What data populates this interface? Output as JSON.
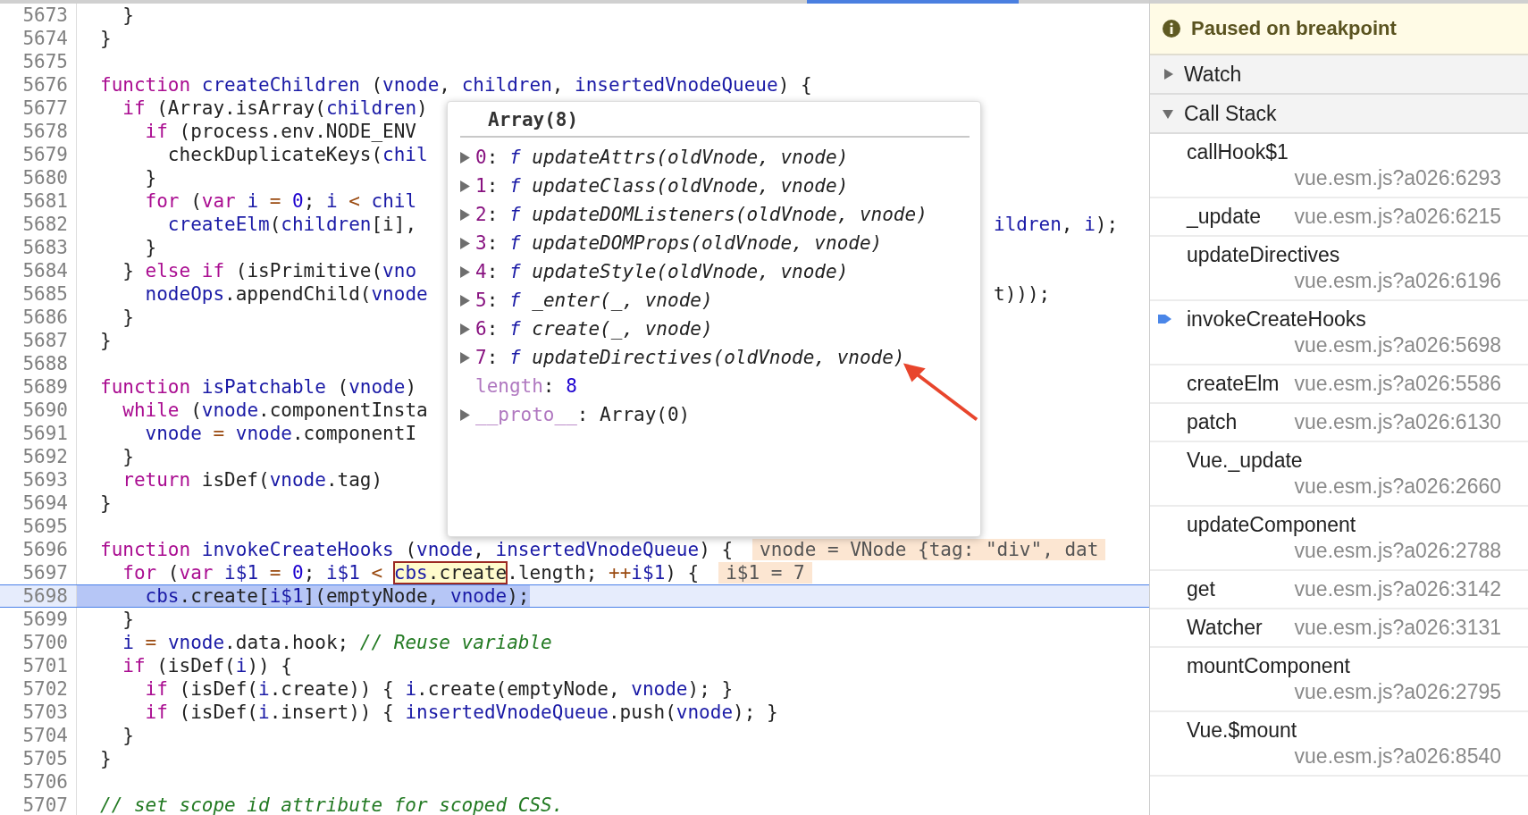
{
  "editor": {
    "lines": [
      {
        "number": "5673",
        "current": false,
        "tokens": [
          {
            "text": "  }",
            "kind": "plain"
          }
        ]
      },
      {
        "number": "5674",
        "current": false,
        "tokens": [
          {
            "text": "}",
            "kind": "plain"
          }
        ]
      },
      {
        "number": "5675",
        "current": false
      },
      {
        "number": "5676",
        "current": false,
        "tokens": [
          {
            "text": "function",
            "kind": "kw"
          },
          {
            "text": " createChildren",
            "kind": "var"
          },
          {
            "text": " (",
            "kind": "plain"
          },
          {
            "text": "vnode",
            "kind": "var"
          },
          {
            "text": ", ",
            "kind": "plain"
          },
          {
            "text": "children",
            "kind": "var"
          },
          {
            "text": ", ",
            "kind": "plain"
          },
          {
            "text": "insertedVnodeQueue",
            "kind": "var"
          },
          {
            "text": ") {",
            "kind": "plain"
          }
        ]
      },
      {
        "number": "5677",
        "current": false,
        "tokens": [
          {
            "text": "  if",
            "kind": "kw"
          },
          {
            "text": " (Array.isArray(",
            "kind": "plain"
          },
          {
            "text": "children",
            "kind": "var"
          },
          {
            "text": ")",
            "kind": "plain"
          }
        ]
      },
      {
        "number": "5678",
        "current": false,
        "tokens": [
          {
            "text": "    if",
            "kind": "kw"
          },
          {
            "text": " (process.env.NODE_ENV",
            "kind": "plain"
          }
        ]
      },
      {
        "number": "5679",
        "current": false,
        "tokens": [
          {
            "text": "      checkDuplicateKeys(",
            "kind": "plain"
          },
          {
            "text": "chil",
            "kind": "var"
          }
        ]
      },
      {
        "number": "5680",
        "current": false,
        "tokens": [
          {
            "text": "    }",
            "kind": "plain"
          }
        ]
      },
      {
        "number": "5681",
        "current": false,
        "tokens": [
          {
            "text": "    for",
            "kind": "kw"
          },
          {
            "text": " (",
            "kind": "plain"
          },
          {
            "text": "var",
            "kind": "kw"
          },
          {
            "text": " i",
            "kind": "var"
          },
          {
            "text": " =",
            "kind": "op"
          },
          {
            "text": " 0",
            "kind": "num"
          },
          {
            "text": "; ",
            "kind": "plain"
          },
          {
            "text": "i",
            "kind": "var"
          },
          {
            "text": " <",
            "kind": "op"
          },
          {
            "text": " chil",
            "kind": "var"
          }
        ]
      },
      {
        "number": "5682",
        "current": false,
        "tokens": [
          {
            "text": "      createElm",
            "kind": "var"
          },
          {
            "text": "(",
            "kind": "plain"
          },
          {
            "text": "children",
            "kind": "var"
          },
          {
            "text": "[i],",
            "kind": "plain"
          }
        ],
        "tail": [
          {
            "text": "ildren",
            "kind": "var"
          },
          {
            "text": ", ",
            "kind": "plain"
          },
          {
            "text": "i",
            "kind": "var"
          },
          {
            "text": ");",
            "kind": "plain"
          }
        ]
      },
      {
        "number": "5683",
        "current": false,
        "tokens": [
          {
            "text": "    }",
            "kind": "plain"
          }
        ]
      },
      {
        "number": "5684",
        "current": false,
        "tokens": [
          {
            "text": "  } ",
            "kind": "plain"
          },
          {
            "text": "else",
            "kind": "kw"
          },
          {
            "text": " if",
            "kind": "kw"
          },
          {
            "text": " (isPrimitive(",
            "kind": "plain"
          },
          {
            "text": "vno",
            "kind": "var"
          }
        ]
      },
      {
        "number": "5685",
        "current": false,
        "tokens": [
          {
            "text": "    nodeOps",
            "kind": "var"
          },
          {
            "text": ".appendChild(",
            "kind": "plain"
          },
          {
            "text": "vnode",
            "kind": "var"
          }
        ],
        "tail": [
          {
            "text": "t)));",
            "kind": "plain"
          }
        ]
      },
      {
        "number": "5686",
        "current": false,
        "tokens": [
          {
            "text": "  }",
            "kind": "plain"
          }
        ]
      },
      {
        "number": "5687",
        "current": false,
        "tokens": [
          {
            "text": "}",
            "kind": "plain"
          }
        ]
      },
      {
        "number": "5688",
        "current": false
      },
      {
        "number": "5689",
        "current": false,
        "tokens": [
          {
            "text": "function",
            "kind": "kw"
          },
          {
            "text": " isPatchable",
            "kind": "var"
          },
          {
            "text": " (",
            "kind": "plain"
          },
          {
            "text": "vnode",
            "kind": "var"
          },
          {
            "text": ")",
            "kind": "plain"
          }
        ]
      },
      {
        "number": "5690",
        "current": false,
        "tokens": [
          {
            "text": "  while",
            "kind": "kw"
          },
          {
            "text": " (",
            "kind": "plain"
          },
          {
            "text": "vnode",
            "kind": "var"
          },
          {
            "text": ".componentInsta",
            "kind": "plain"
          }
        ]
      },
      {
        "number": "5691",
        "current": false,
        "tokens": [
          {
            "text": "    vnode",
            "kind": "var"
          },
          {
            "text": " =",
            "kind": "op"
          },
          {
            "text": " vnode",
            "kind": "var"
          },
          {
            "text": ".componentI",
            "kind": "plain"
          }
        ]
      },
      {
        "number": "5692",
        "current": false,
        "tokens": [
          {
            "text": "  }",
            "kind": "plain"
          }
        ]
      },
      {
        "number": "5693",
        "current": false,
        "tokens": [
          {
            "text": "  return",
            "kind": "kw"
          },
          {
            "text": " isDef(",
            "kind": "plain"
          },
          {
            "text": "vnode",
            "kind": "var"
          },
          {
            "text": ".tag)",
            "kind": "plain"
          }
        ]
      },
      {
        "number": "5694",
        "current": false,
        "tokens": [
          {
            "text": "}",
            "kind": "plain"
          }
        ]
      },
      {
        "number": "5695",
        "current": false
      },
      {
        "number": "5696",
        "current": false,
        "tokens": [
          {
            "text": "function",
            "kind": "kw"
          },
          {
            "text": " invokeCreateHooks",
            "kind": "var"
          },
          {
            "text": " (",
            "kind": "plain"
          },
          {
            "text": "vnode",
            "kind": "var"
          },
          {
            "text": ", ",
            "kind": "plain"
          },
          {
            "text": "insertedVnodeQueue",
            "kind": "var"
          },
          {
            "text": ") {",
            "kind": "plain"
          }
        ],
        "inline_value": "vnode = VNode {tag: \"div\", dat"
      },
      {
        "number": "5697",
        "current": false,
        "tokens": [
          {
            "text": "  for",
            "kind": "kw"
          },
          {
            "text": " (",
            "kind": "plain"
          },
          {
            "text": "var",
            "kind": "kw"
          },
          {
            "text": " i$1",
            "kind": "var"
          },
          {
            "text": " =",
            "kind": "op"
          },
          {
            "text": " 0",
            "kind": "num"
          },
          {
            "text": "; ",
            "kind": "plain"
          },
          {
            "text": "i$1",
            "kind": "var"
          },
          {
            "text": " < ",
            "kind": "op"
          },
          {
            "kind": "hovered",
            "parts": [
              {
                "text": "cbs",
                "kind": "var"
              },
              {
                "text": ".create",
                "kind": "plain"
              }
            ]
          },
          {
            "text": ".length; ",
            "kind": "plain"
          },
          {
            "text": "++",
            "kind": "op"
          },
          {
            "text": "i$1",
            "kind": "var"
          },
          {
            "text": ") {",
            "kind": "plain"
          }
        ],
        "inline_value": "i$1 = 7"
      },
      {
        "number": "5698",
        "current": true,
        "tokens": [
          {
            "text": "    cbs",
            "kind": "var"
          },
          {
            "text": ".create[",
            "kind": "plain"
          },
          {
            "text": "i$1",
            "kind": "var"
          },
          {
            "text": "](emptyNode, ",
            "kind": "plain"
          },
          {
            "text": "vnode",
            "kind": "var"
          },
          {
            "text": ");",
            "kind": "plain"
          }
        ]
      },
      {
        "number": "5699",
        "current": false,
        "tokens": [
          {
            "text": "  }",
            "kind": "plain"
          }
        ]
      },
      {
        "number": "5700",
        "current": false,
        "tokens": [
          {
            "text": "  i",
            "kind": "var"
          },
          {
            "text": " =",
            "kind": "op"
          },
          {
            "text": " vnode",
            "kind": "var"
          },
          {
            "text": ".data.hook; ",
            "kind": "plain"
          },
          {
            "text": "// Reuse variable",
            "kind": "cmt"
          }
        ]
      },
      {
        "number": "5701",
        "current": false,
        "tokens": [
          {
            "text": "  if",
            "kind": "kw"
          },
          {
            "text": " (isDef(",
            "kind": "plain"
          },
          {
            "text": "i",
            "kind": "var"
          },
          {
            "text": ")) {",
            "kind": "plain"
          }
        ]
      },
      {
        "number": "5702",
        "current": false,
        "tokens": [
          {
            "text": "    if",
            "kind": "kw"
          },
          {
            "text": " (isDef(",
            "kind": "plain"
          },
          {
            "text": "i",
            "kind": "var"
          },
          {
            "text": ".create)) { ",
            "kind": "plain"
          },
          {
            "text": "i",
            "kind": "var"
          },
          {
            "text": ".create(emptyNode, ",
            "kind": "plain"
          },
          {
            "text": "vnode",
            "kind": "var"
          },
          {
            "text": "); }",
            "kind": "plain"
          }
        ]
      },
      {
        "number": "5703",
        "current": false,
        "tokens": [
          {
            "text": "    if",
            "kind": "kw"
          },
          {
            "text": " (isDef(",
            "kind": "plain"
          },
          {
            "text": "i",
            "kind": "var"
          },
          {
            "text": ".insert)) { ",
            "kind": "plain"
          },
          {
            "text": "insertedVnodeQueue",
            "kind": "var"
          },
          {
            "text": ".push(",
            "kind": "plain"
          },
          {
            "text": "vnode",
            "kind": "var"
          },
          {
            "text": "); }",
            "kind": "plain"
          }
        ]
      },
      {
        "number": "5704",
        "current": false,
        "tokens": [
          {
            "text": "  }",
            "kind": "plain"
          }
        ]
      },
      {
        "number": "5705",
        "current": false,
        "tokens": [
          {
            "text": "}",
            "kind": "plain"
          }
        ]
      },
      {
        "number": "5706",
        "current": false
      },
      {
        "number": "5707",
        "current": false,
        "tokens": [
          {
            "text": "// set scope id attribute for scoped CSS.",
            "kind": "cmt"
          }
        ]
      }
    ]
  },
  "popover": {
    "title": "Array(8)",
    "entries": [
      {
        "kind": "function",
        "expandable": true,
        "key": "0",
        "sep": ":",
        "type_mark": "f",
        "value": "updateAttrs(oldVnode, vnode)"
      },
      {
        "kind": "function",
        "expandable": true,
        "key": "1",
        "sep": ":",
        "type_mark": "f",
        "value": "updateClass(oldVnode, vnode)"
      },
      {
        "kind": "function",
        "expandable": true,
        "key": "2",
        "sep": ":",
        "type_mark": "f",
        "value": "updateDOMListeners(oldVnode, vnode)"
      },
      {
        "kind": "function",
        "expandable": true,
        "key": "3",
        "sep": ":",
        "type_mark": "f",
        "value": "updateDOMProps(oldVnode, vnode)"
      },
      {
        "kind": "function",
        "expandable": true,
        "key": "4",
        "sep": ":",
        "type_mark": "f",
        "value": "updateStyle(oldVnode, vnode)"
      },
      {
        "kind": "function",
        "expandable": true,
        "key": "5",
        "sep": ":",
        "type_mark": "f",
        "value": "_enter(_, vnode)"
      },
      {
        "kind": "function",
        "expandable": true,
        "key": "6",
        "sep": ":",
        "type_mark": "f",
        "value": "create(_, vnode)"
      },
      {
        "kind": "function",
        "expandable": true,
        "key": "7",
        "sep": ":",
        "type_mark": "f",
        "value": "updateDirectives(oldVnode, vnode)"
      },
      {
        "kind": "number",
        "expandable": false,
        "key": "length",
        "sep": ":",
        "value": "8"
      },
      {
        "kind": "object",
        "expandable": true,
        "key": "__proto__",
        "sep": ":",
        "value": "Array(0)"
      }
    ]
  },
  "debugger": {
    "banner": "Paused on breakpoint",
    "sections": [
      {
        "title": "Watch",
        "expanded": false
      },
      {
        "title": "Call Stack",
        "expanded": true
      }
    ],
    "call_stack": [
      {
        "name": "callHook$1",
        "location": "vue.esm.js?a026:6293",
        "current": false
      },
      {
        "name": "_update",
        "location": "vue.esm.js?a026:6215",
        "current": false
      },
      {
        "name": "updateDirectives",
        "location": "vue.esm.js?a026:6196",
        "current": false
      },
      {
        "name": "invokeCreateHooks",
        "location": "vue.esm.js?a026:5698",
        "current": true
      },
      {
        "name": "createElm",
        "location": "vue.esm.js?a026:5586",
        "current": false
      },
      {
        "name": "patch",
        "location": "vue.esm.js?a026:6130",
        "current": false
      },
      {
        "name": "Vue._update",
        "location": "vue.esm.js?a026:2660",
        "current": false
      },
      {
        "name": "updateComponent",
        "location": "vue.esm.js?a026:2788",
        "current": false
      },
      {
        "name": "get",
        "location": "vue.esm.js?a026:3142",
        "current": false
      },
      {
        "name": "Watcher",
        "location": "vue.esm.js?a026:3131",
        "current": false
      },
      {
        "name": "mountComponent",
        "location": "vue.esm.js?a026:2795",
        "current": false
      },
      {
        "name": "Vue.$mount",
        "location": "vue.esm.js?a026:8540",
        "current": false
      }
    ]
  }
}
